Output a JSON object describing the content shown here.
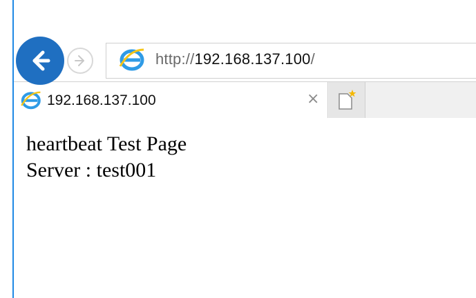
{
  "navigation": {
    "back_icon": "back-arrow-icon",
    "forward_icon": "forward-arrow-icon",
    "address": {
      "scheme": "http://",
      "host": "192.168.137.100",
      "path": "/",
      "icon": "internet-explorer-icon"
    }
  },
  "tabs": [
    {
      "title": "192.168.137.100",
      "icon": "internet-explorer-icon",
      "close_label": "×"
    }
  ],
  "new_tab_icon": "new-tab-icon",
  "page": {
    "line1": "heartbeat Test Page",
    "line2": "Server : test001"
  },
  "colors": {
    "accent": "#1f6fc1",
    "border_left": "#1e88e5",
    "ie_blue": "#2f9be6",
    "ie_gold": "#f5c518"
  }
}
